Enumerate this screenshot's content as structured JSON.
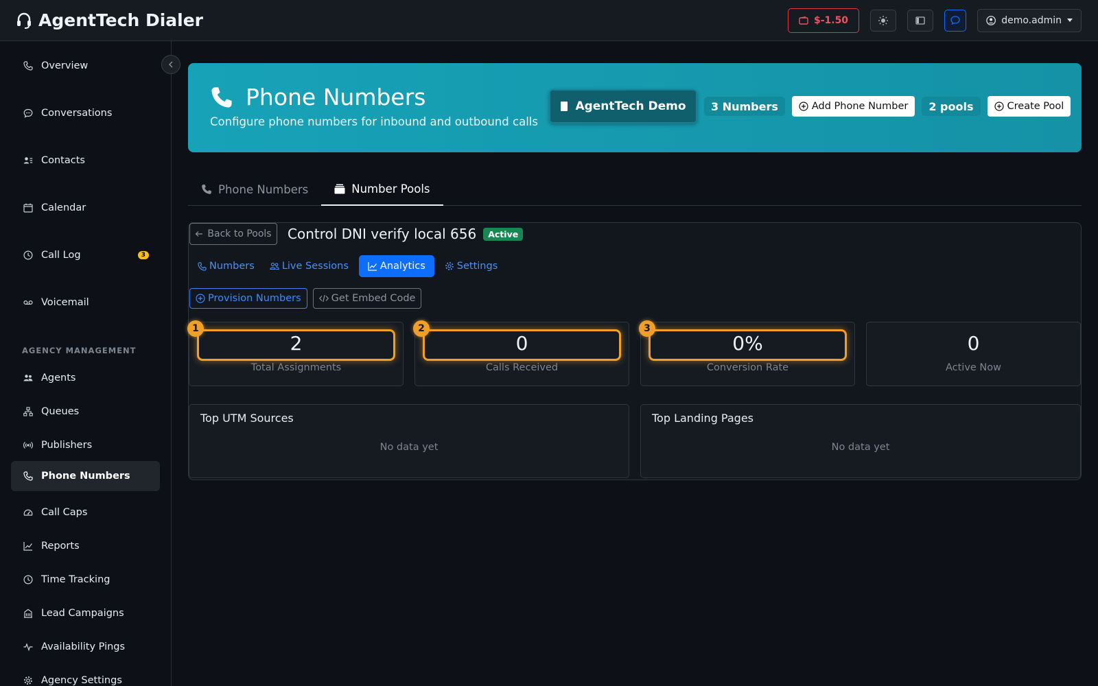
{
  "app": {
    "title": "AgentTech Dialer"
  },
  "topbar": {
    "balance": "$-1.50",
    "username": "demo.admin"
  },
  "sidebar": {
    "items": [
      {
        "label": "Overview",
        "icon": "phone-icon"
      },
      {
        "label": "Conversations",
        "icon": "chat-icon"
      },
      {
        "label": "Contacts",
        "icon": "contacts-icon"
      },
      {
        "label": "Calendar",
        "icon": "calendar-icon"
      },
      {
        "label": "Call Log",
        "icon": "clock-icon",
        "badge": "3"
      },
      {
        "label": "Voicemail",
        "icon": "voicemail-icon"
      }
    ],
    "section_label": "AGENCY MANAGEMENT",
    "agency_items": [
      {
        "label": "Agents",
        "icon": "people-icon"
      },
      {
        "label": "Queues",
        "icon": "diagram-icon"
      },
      {
        "label": "Publishers",
        "icon": "broadcast-icon"
      },
      {
        "label": "Phone Numbers",
        "icon": "phone-icon",
        "active": true
      },
      {
        "label": "Call Caps",
        "icon": "speedometer-icon"
      },
      {
        "label": "Reports",
        "icon": "chart-icon"
      },
      {
        "label": "Time Tracking",
        "icon": "clock-icon"
      },
      {
        "label": "Lead Campaigns",
        "icon": "building-icon"
      },
      {
        "label": "Availability Pings",
        "icon": "activity-icon"
      },
      {
        "label": "Agency Settings",
        "icon": "gear-icon"
      }
    ]
  },
  "hero": {
    "title": "Phone Numbers",
    "subtitle": "Configure phone numbers for inbound and outbound calls",
    "agency": "AgentTech Demo",
    "numbers_count": "3 Numbers",
    "add_number": "Add Phone Number",
    "pools_count": "2 pools",
    "create_pool": "Create Pool"
  },
  "tabs": {
    "phone_numbers": "Phone Numbers",
    "number_pools": "Number Pools"
  },
  "pool": {
    "back": "Back to Pools",
    "name": "Control DNI verify local 656",
    "status": "Active",
    "subtabs": {
      "numbers": "Numbers",
      "live_sessions": "Live Sessions",
      "analytics": "Analytics",
      "settings": "Settings"
    },
    "provision": "Provision Numbers",
    "embed": "Get Embed Code",
    "stats": [
      {
        "value": "2",
        "label": "Total Assignments",
        "marker": "1"
      },
      {
        "value": "0",
        "label": "Calls Received",
        "marker": "2"
      },
      {
        "value": "0%",
        "label": "Conversion Rate",
        "marker": "3"
      },
      {
        "value": "0",
        "label": "Active Now"
      }
    ],
    "utm_title": "Top UTM Sources",
    "landing_title": "Top Landing Pages",
    "empty": "No data yet"
  },
  "colors": {
    "accent": "#17a2b8",
    "primary": "#0d6efd",
    "highlight": "#f0a028",
    "danger": "#dc3545",
    "success": "#198754"
  }
}
